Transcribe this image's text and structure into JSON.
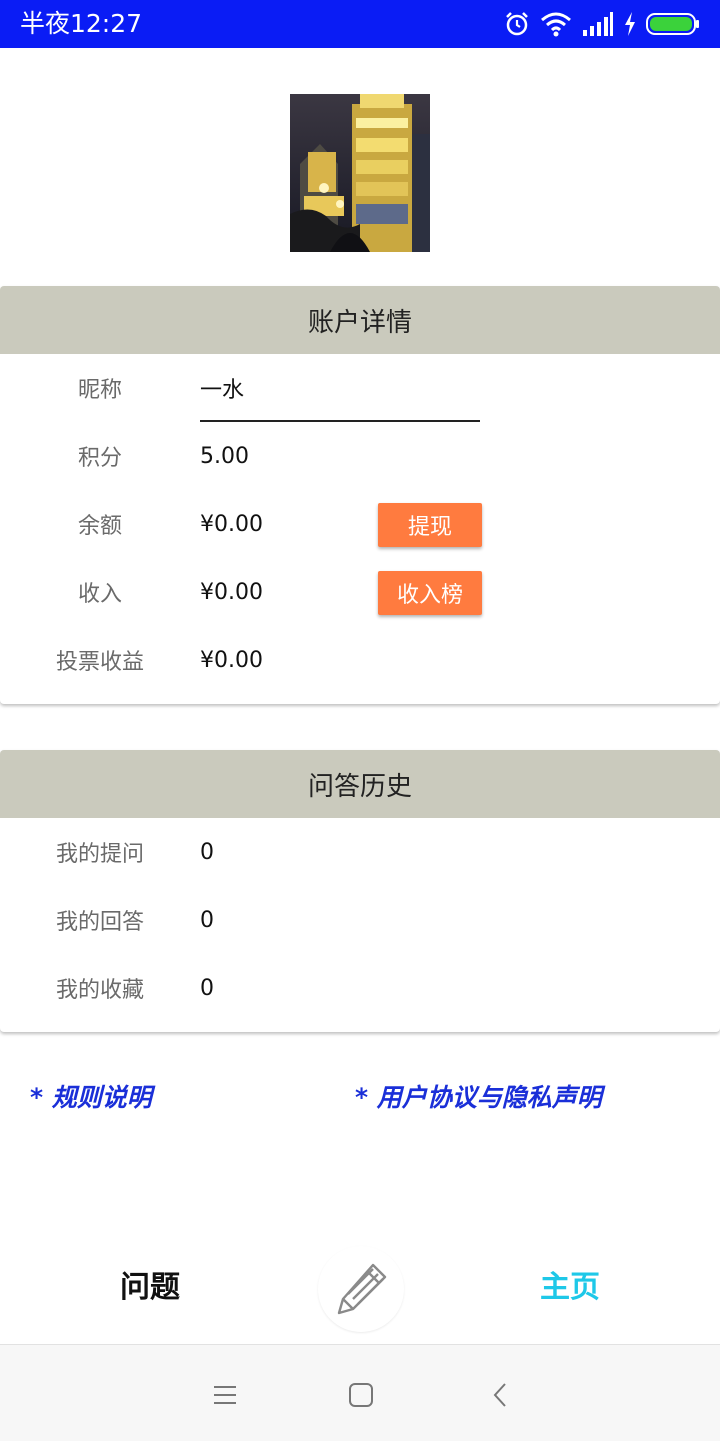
{
  "status_bar": {
    "time": "半夜12:27"
  },
  "account": {
    "title": "账户详情",
    "rows": [
      {
        "label": "昵称",
        "value": "一水"
      },
      {
        "label": "积分",
        "value": "5.00"
      },
      {
        "label": "余额",
        "value": "¥0.00",
        "button": "提现"
      },
      {
        "label": "收入",
        "value": "¥0.00",
        "button": "收入榜"
      },
      {
        "label": "投票收益",
        "value": "¥0.00"
      }
    ]
  },
  "history": {
    "title": "问答历史",
    "rows": [
      {
        "label": "我的提问",
        "value": "0"
      },
      {
        "label": "我的回答",
        "value": "0"
      },
      {
        "label": "我的收藏",
        "value": "0"
      }
    ]
  },
  "links": {
    "rules": "* 规则说明",
    "agreement": "* 用户协议与隐私声明"
  },
  "bottom_tabs": {
    "questions": "问题",
    "home": "主页",
    "compose_icon": "pencil-icon"
  },
  "colors": {
    "status_bar": "#0a1cf5",
    "card_header": "#cacabd",
    "button": "#ff7b3f",
    "link": "#1a2fd8",
    "home_active": "#1ec8e8"
  }
}
